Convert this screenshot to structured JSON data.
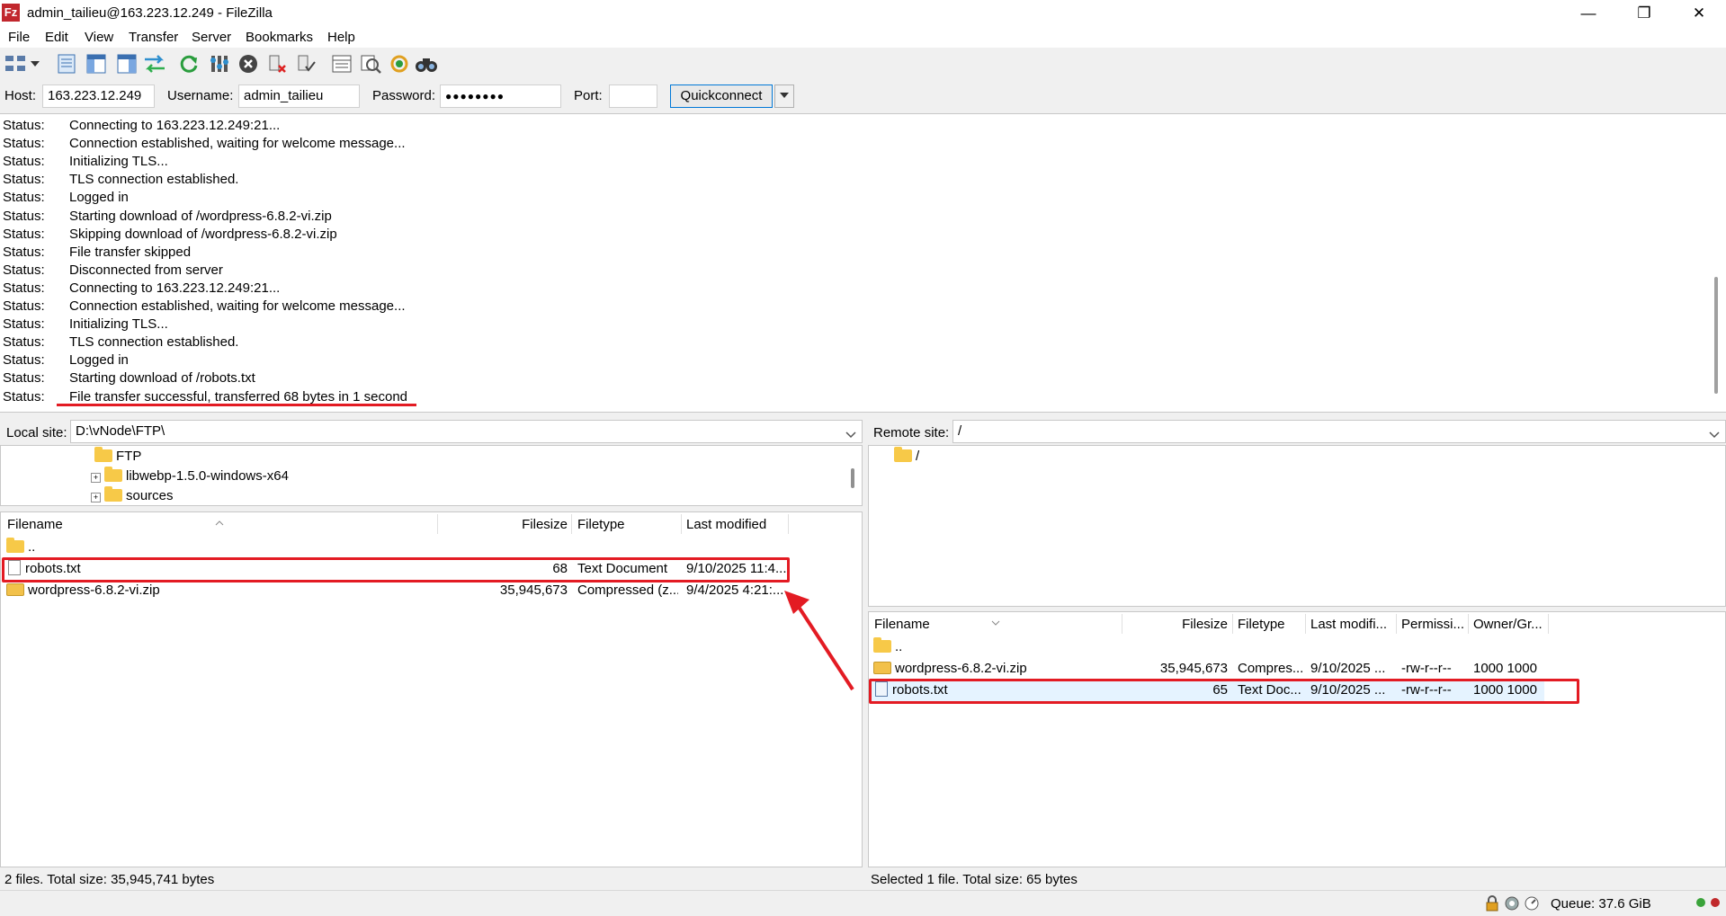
{
  "window": {
    "title": "admin_tailieu@163.223.12.249 - FileZilla",
    "app_icon_text": "Fz",
    "minimize": "—",
    "restore": "❐",
    "close": "✕"
  },
  "menu": [
    "File",
    "Edit",
    "View",
    "Transfer",
    "Server",
    "Bookmarks",
    "Help"
  ],
  "quickconnect": {
    "host_label": "Host:",
    "host_value": "163.223.12.249",
    "username_label": "Username:",
    "username_value": "admin_tailieu",
    "password_label": "Password:",
    "password_value": "●●●●●●●●",
    "port_label": "Port:",
    "port_value": "",
    "button_label": "Quickconnect"
  },
  "log": [
    {
      "k": "Status:",
      "v": "Connecting to 163.223.12.249:21..."
    },
    {
      "k": "Status:",
      "v": "Connection established, waiting for welcome message..."
    },
    {
      "k": "Status:",
      "v": "Initializing TLS..."
    },
    {
      "k": "Status:",
      "v": "TLS connection established."
    },
    {
      "k": "Status:",
      "v": "Logged in"
    },
    {
      "k": "Status:",
      "v": "Starting download of /wordpress-6.8.2-vi.zip"
    },
    {
      "k": "Status:",
      "v": "Skipping download of /wordpress-6.8.2-vi.zip"
    },
    {
      "k": "Status:",
      "v": "File transfer skipped"
    },
    {
      "k": "Status:",
      "v": "Disconnected from server"
    },
    {
      "k": "Status:",
      "v": "Connecting to 163.223.12.249:21..."
    },
    {
      "k": "Status:",
      "v": "Connection established, waiting for welcome message..."
    },
    {
      "k": "Status:",
      "v": "Initializing TLS..."
    },
    {
      "k": "Status:",
      "v": "TLS connection established."
    },
    {
      "k": "Status:",
      "v": "Logged in"
    },
    {
      "k": "Status:",
      "v": "Starting download of /robots.txt"
    },
    {
      "k": "Status:",
      "v": "File transfer successful, transferred 68 bytes in 1 second"
    }
  ],
  "local": {
    "site_label": "Local site:",
    "site_path": "D:\\vNode\\FTP\\",
    "tree": [
      {
        "label": "FTP",
        "expander": ""
      },
      {
        "label": "libwebp-1.5.0-windows-x64",
        "expander": "+"
      },
      {
        "label": "sources",
        "expander": "+"
      }
    ],
    "headers": {
      "name": "Filename",
      "size": "Filesize",
      "type": "Filetype",
      "modified": "Last modified"
    },
    "files": [
      {
        "name": "..",
        "size": "",
        "type": "",
        "modified": ""
      },
      {
        "name": "robots.txt",
        "size": "68",
        "type": "Text Document",
        "modified": "9/10/2025 11:4..."
      },
      {
        "name": "wordpress-6.8.2-vi.zip",
        "size": "35,945,673",
        "type": "Compressed (z...",
        "modified": "9/4/2025 4:21:..."
      }
    ],
    "status": "2 files. Total size: 35,945,741 bytes"
  },
  "remote": {
    "site_label": "Remote site:",
    "site_path": "/",
    "tree": [
      {
        "label": "/"
      }
    ],
    "headers": {
      "name": "Filename",
      "size": "Filesize",
      "type": "Filetype",
      "modified": "Last modifi...",
      "perms": "Permissi...",
      "owner": "Owner/Gr..."
    },
    "files": [
      {
        "name": "..",
        "size": "",
        "type": "",
        "modified": "",
        "perms": "",
        "owner": ""
      },
      {
        "name": "wordpress-6.8.2-vi.zip",
        "size": "35,945,673",
        "type": "Compres...",
        "modified": "9/10/2025 ...",
        "perms": "-rw-r--r--",
        "owner": "1000 1000"
      },
      {
        "name": "robots.txt",
        "size": "65",
        "type": "Text Doc...",
        "modified": "9/10/2025 ...",
        "perms": "-rw-r--r--",
        "owner": "1000 1000"
      }
    ],
    "status": "Selected 1 file. Total size: 65 bytes"
  },
  "queue": "Queue: 37.6 GiB",
  "colors": {
    "annotation": "#e31b23",
    "selection": "#e5f3ff"
  }
}
